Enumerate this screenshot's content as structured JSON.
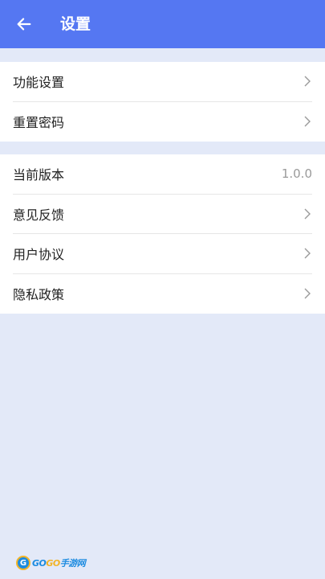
{
  "header": {
    "title": "设置",
    "back_icon": "arrow-left-icon"
  },
  "group1": {
    "items": [
      {
        "label": "功能设置",
        "icon": "chevron-right-icon"
      },
      {
        "label": "重置密码",
        "icon": "chevron-right-icon"
      }
    ]
  },
  "group2": {
    "items": [
      {
        "label": "当前版本",
        "value": "1.0.0"
      },
      {
        "label": "意见反馈",
        "icon": "chevron-right-icon"
      },
      {
        "label": "用户协议",
        "icon": "chevron-right-icon"
      },
      {
        "label": "隐私政策",
        "icon": "chevron-right-icon"
      }
    ]
  },
  "watermark": {
    "mark": "G",
    "part1": "GO",
    "part2": "GO",
    "part3": "手游网"
  },
  "colors": {
    "header": "#5577f2",
    "background": "#e3e9f8",
    "card": "#ffffff",
    "divider": "#e6e6e6",
    "chevron": "#9a9a9a"
  }
}
